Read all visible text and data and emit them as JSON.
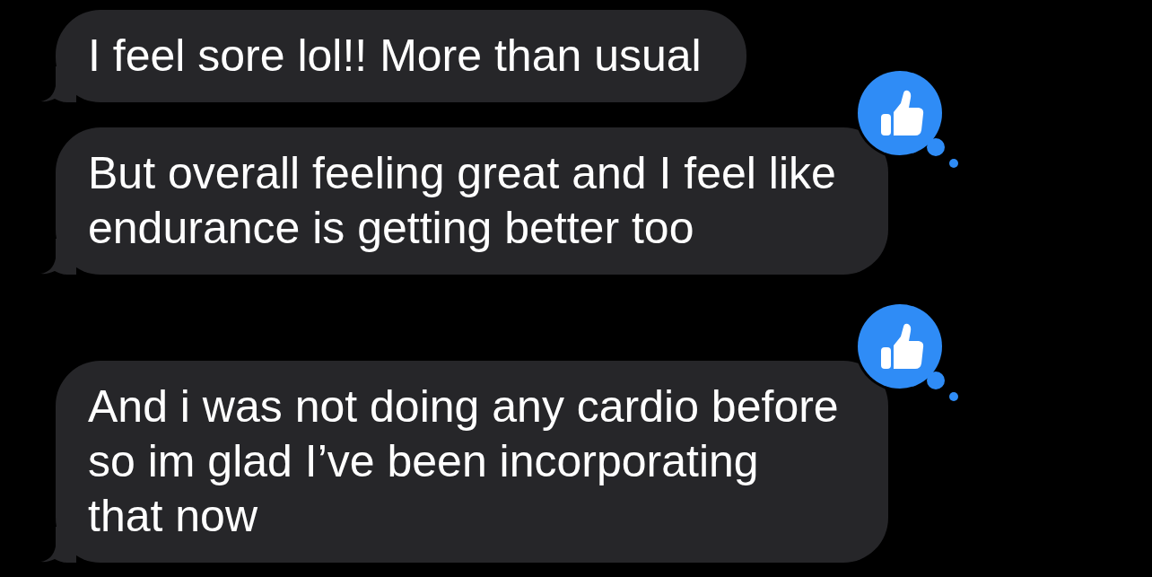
{
  "messages": [
    {
      "text": "I feel sore lol!! More than usual",
      "liked": false
    },
    {
      "text": "But overall feeling great and I feel like endurance is getting better too",
      "liked": true
    },
    {
      "text": "And i was not doing any cardio before so im glad I’ve been incorporating that now",
      "liked": true
    }
  ]
}
